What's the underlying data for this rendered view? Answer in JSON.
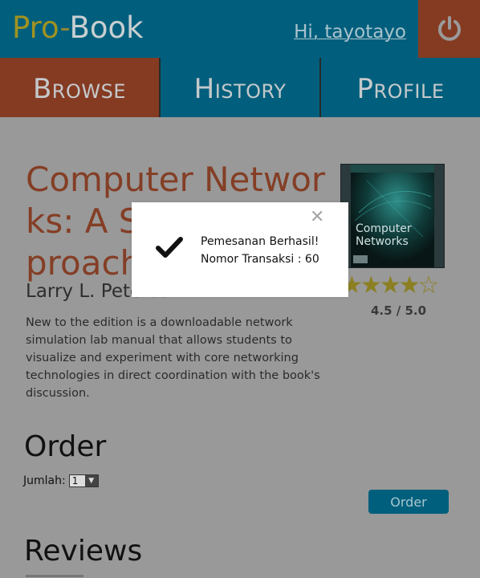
{
  "header": {
    "logo_pro": "Pro",
    "logo_dash": "-",
    "logo_book": "Book",
    "greeting": "Hi, tayotayo",
    "power_icon": "power-icon"
  },
  "nav": {
    "tabs": [
      {
        "label": "Browse",
        "active": true
      },
      {
        "label": "History",
        "active": false
      },
      {
        "label": "Profile",
        "active": false
      }
    ]
  },
  "book": {
    "title": "Computer Networks: A Systems Approach",
    "author": "Larry L. Peterson",
    "description": "New to the edition is a downloadable network simulation lab manual that allows students to visualize and experiment with core networking technologies in direct coordination with the book's discussion.",
    "cover_title_line1": "Computer",
    "cover_title_line2": "Networks",
    "rating_value": 4.5,
    "rating_text": "4.5 / 5.0"
  },
  "order": {
    "heading": "Order",
    "quantity_label": "Jumlah:",
    "quantity_value": "1",
    "button_label": "Order"
  },
  "reviews": {
    "heading": "Reviews"
  },
  "modal": {
    "close_symbol": "✕",
    "line1": "Pemesanan Berhasil!",
    "line2": "Nomor Transaksi : 60"
  },
  "colors": {
    "header_bg": "#015f7d",
    "accent_orange": "#853b22",
    "overlay_gray": "#999999"
  }
}
